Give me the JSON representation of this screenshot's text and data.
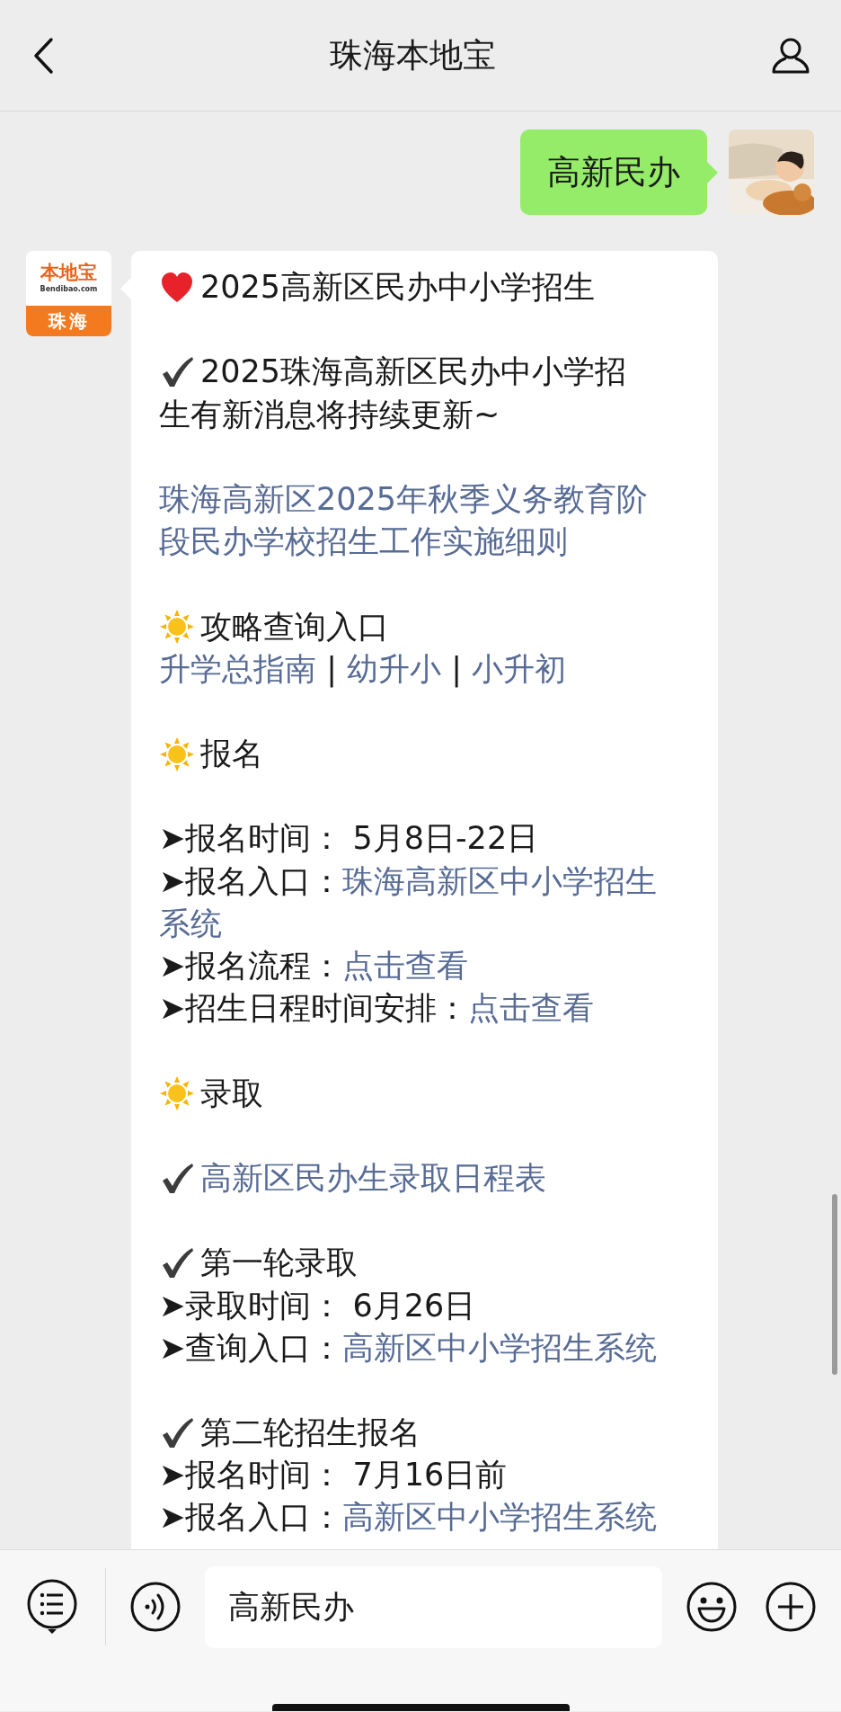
{
  "header": {
    "title": "珠海本地宝"
  },
  "messages": [
    {
      "kind": "sent",
      "text": "高新民办"
    },
    {
      "kind": "received",
      "logo": {
        "brand": "本地宝",
        "domain": "Bendibao.com",
        "city": "珠海"
      },
      "blocks": [
        {
          "lines": [
            {
              "kind": "heart",
              "segs": [
                {
                  "text": "2025高新区民办中小学招生",
                  "link": false
                }
              ]
            }
          ]
        },
        {
          "lines": [
            {
              "kind": "check",
              "segs": [
                {
                  "text": "2025珠海高新区民办中小学招",
                  "link": false
                }
              ]
            },
            {
              "segs": [
                {
                  "text": "生有新消息将持续更新~",
                  "link": false
                }
              ]
            }
          ]
        },
        {
          "lines": [
            {
              "segs": [
                {
                  "text": "珠海高新区2025年秋季义务教育阶",
                  "link": true
                }
              ]
            },
            {
              "segs": [
                {
                  "text": "段民办学校招生工作实施细则",
                  "link": true
                }
              ]
            }
          ]
        },
        {
          "lines": [
            {
              "kind": "sun",
              "segs": [
                {
                  "text": "攻略查询入口",
                  "link": false
                }
              ]
            },
            {
              "segs": [
                {
                  "text": "升学总指南",
                  "link": true
                },
                {
                  "text": " | ",
                  "link": false
                },
                {
                  "text": "幼升小",
                  "link": true
                },
                {
                  "text": " | ",
                  "link": false
                },
                {
                  "text": "小升初",
                  "link": true
                }
              ]
            }
          ]
        },
        {
          "lines": [
            {
              "kind": "sun",
              "segs": [
                {
                  "text": "报名",
                  "link": false
                }
              ]
            }
          ]
        },
        {
          "lines": [
            {
              "segs": [
                {
                  "text": "➤报名时间： 5月8日-22日",
                  "link": false
                }
              ]
            },
            {
              "segs": [
                {
                  "text": "➤报名入口：",
                  "link": false
                },
                {
                  "text": "珠海高新区中小学招生",
                  "link": true
                }
              ]
            },
            {
              "segs": [
                {
                  "text": "系统",
                  "link": true
                }
              ]
            },
            {
              "segs": [
                {
                  "text": "➤报名流程：",
                  "link": false
                },
                {
                  "text": "点击查看",
                  "link": true
                }
              ]
            },
            {
              "segs": [
                {
                  "text": "➤招生日程时间安排：",
                  "link": false
                },
                {
                  "text": "点击查看",
                  "link": true
                }
              ]
            }
          ]
        },
        {
          "lines": [
            {
              "kind": "sun",
              "segs": [
                {
                  "text": "录取",
                  "link": false
                }
              ]
            }
          ]
        },
        {
          "lines": [
            {
              "kind": "check",
              "segs": [
                {
                  "text": "高新区民办生录取日程表",
                  "link": true
                }
              ]
            }
          ]
        },
        {
          "lines": [
            {
              "kind": "check",
              "segs": [
                {
                  "text": "第一轮录取",
                  "link": false
                }
              ]
            },
            {
              "segs": [
                {
                  "text": "➤录取时间： 6月26日",
                  "link": false
                }
              ]
            },
            {
              "segs": [
                {
                  "text": "➤查询入口：",
                  "link": false
                },
                {
                  "text": "高新区中小学招生系统",
                  "link": true
                }
              ]
            }
          ]
        },
        {
          "lines": [
            {
              "kind": "check",
              "segs": [
                {
                  "text": "第二轮招生报名",
                  "link": false
                }
              ]
            },
            {
              "segs": [
                {
                  "text": "➤报名时间： 7月16日前",
                  "link": false
                }
              ]
            },
            {
              "segs": [
                {
                  "text": "➤报名入口：",
                  "link": false
                },
                {
                  "text": "高新区中小学招生系统",
                  "link": true
                }
              ]
            }
          ]
        }
      ]
    }
  ],
  "input": {
    "value": "高新民办"
  }
}
